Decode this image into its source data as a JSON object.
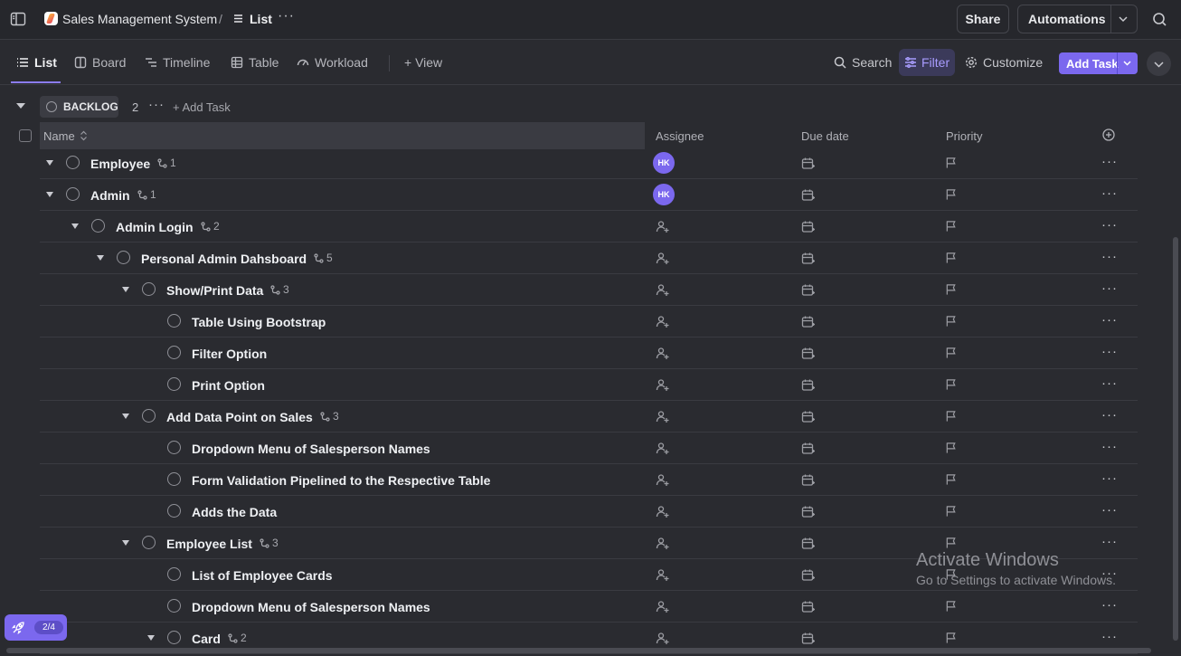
{
  "breadcrumb": {
    "space": "Sales Management System",
    "separator": "/",
    "list": "List",
    "more": "···"
  },
  "top_actions": {
    "share": "Share",
    "automations": "Automations"
  },
  "views": [
    {
      "label": "List",
      "icon": "list-icon",
      "active": true
    },
    {
      "label": "Board",
      "icon": "board-icon",
      "active": false
    },
    {
      "label": "Timeline",
      "icon": "timeline-icon",
      "active": false
    },
    {
      "label": "Table",
      "icon": "table-icon",
      "active": false
    },
    {
      "label": "Workload",
      "icon": "workload-icon",
      "active": false
    }
  ],
  "add_view": "+ View",
  "tools": {
    "search": "Search",
    "filter": "Filter",
    "customize": "Customize",
    "add_task": "Add Task"
  },
  "group": {
    "status": "BACKLOG",
    "count": "2",
    "more": "···",
    "add_task": "+ Add Task"
  },
  "columns": {
    "name": "Name",
    "assignee": "Assignee",
    "due_date": "Due date",
    "priority": "Priority"
  },
  "rows": [
    {
      "name": "Employee",
      "subtasks": "1",
      "level": 0,
      "expandable": true,
      "assignee": "HK"
    },
    {
      "name": "Admin",
      "subtasks": "1",
      "level": 0,
      "expandable": true,
      "assignee": "HK"
    },
    {
      "name": "Admin Login",
      "subtasks": "2",
      "level": 1,
      "expandable": true,
      "assignee": ""
    },
    {
      "name": "Personal Admin Dahsboard",
      "subtasks": "5",
      "level": 2,
      "expandable": true,
      "assignee": ""
    },
    {
      "name": "Show/Print Data",
      "subtasks": "3",
      "level": 3,
      "expandable": true,
      "assignee": ""
    },
    {
      "name": "Table Using Bootstrap",
      "subtasks": "",
      "level": 4,
      "expandable": false,
      "assignee": ""
    },
    {
      "name": "Filter Option",
      "subtasks": "",
      "level": 4,
      "expandable": false,
      "assignee": ""
    },
    {
      "name": "Print Option",
      "subtasks": "",
      "level": 4,
      "expandable": false,
      "assignee": ""
    },
    {
      "name": "Add Data Point on Sales",
      "subtasks": "3",
      "level": 3,
      "expandable": true,
      "assignee": ""
    },
    {
      "name": "Dropdown Menu of Salesperson Names",
      "subtasks": "",
      "level": 4,
      "expandable": false,
      "assignee": ""
    },
    {
      "name": "Form Validation Pipelined to the Respective Table",
      "subtasks": "",
      "level": 4,
      "expandable": false,
      "assignee": ""
    },
    {
      "name": "Adds the Data",
      "subtasks": "",
      "level": 4,
      "expandable": false,
      "assignee": ""
    },
    {
      "name": "Employee List",
      "subtasks": "3",
      "level": 3,
      "expandable": true,
      "assignee": ""
    },
    {
      "name": "List of Employee Cards",
      "subtasks": "",
      "level": 4,
      "expandable": false,
      "assignee": ""
    },
    {
      "name": "Dropdown Menu of Salesperson Names",
      "subtasks": "",
      "level": 4,
      "expandable": false,
      "assignee": ""
    },
    {
      "name": "Card",
      "subtasks": "2",
      "level": 4,
      "expandable": true,
      "assignee": ""
    }
  ],
  "row_more": "···",
  "watermark": {
    "title": "Activate Windows",
    "subtitle": "Go to Settings to activate Windows."
  },
  "progress": {
    "label": "2/4"
  },
  "colors": {
    "accent": "#7b68ee",
    "background": "#2a2b30"
  }
}
